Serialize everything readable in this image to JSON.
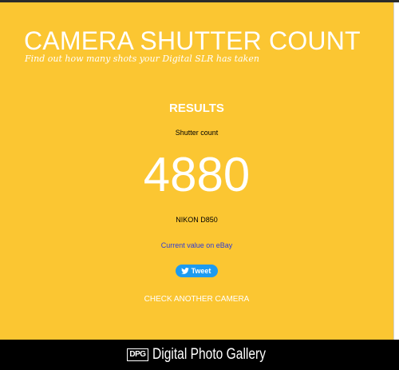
{
  "header": {
    "title": "CAMERA SHUTTER COUNT",
    "tagline": "Find out how many shots your Digital SLR has taken"
  },
  "results": {
    "heading": "RESULTS",
    "count_label": "Shutter count",
    "count_value": "4880",
    "camera_model": "NIKON D850",
    "ebay_link_text": "Current value on eBay",
    "tweet_label": "Tweet",
    "check_another_label": "CHECK ANOTHER CAMERA"
  },
  "footer": {
    "logo_mark": "DPG",
    "brand_name": "Digital Photo Gallery"
  },
  "icons": {
    "tweet": "twitter-bird-icon"
  },
  "colors": {
    "background": "#fbc632",
    "link": "#2e3bd6",
    "tweet_button": "#1d9bf0",
    "footer": "#000000"
  }
}
